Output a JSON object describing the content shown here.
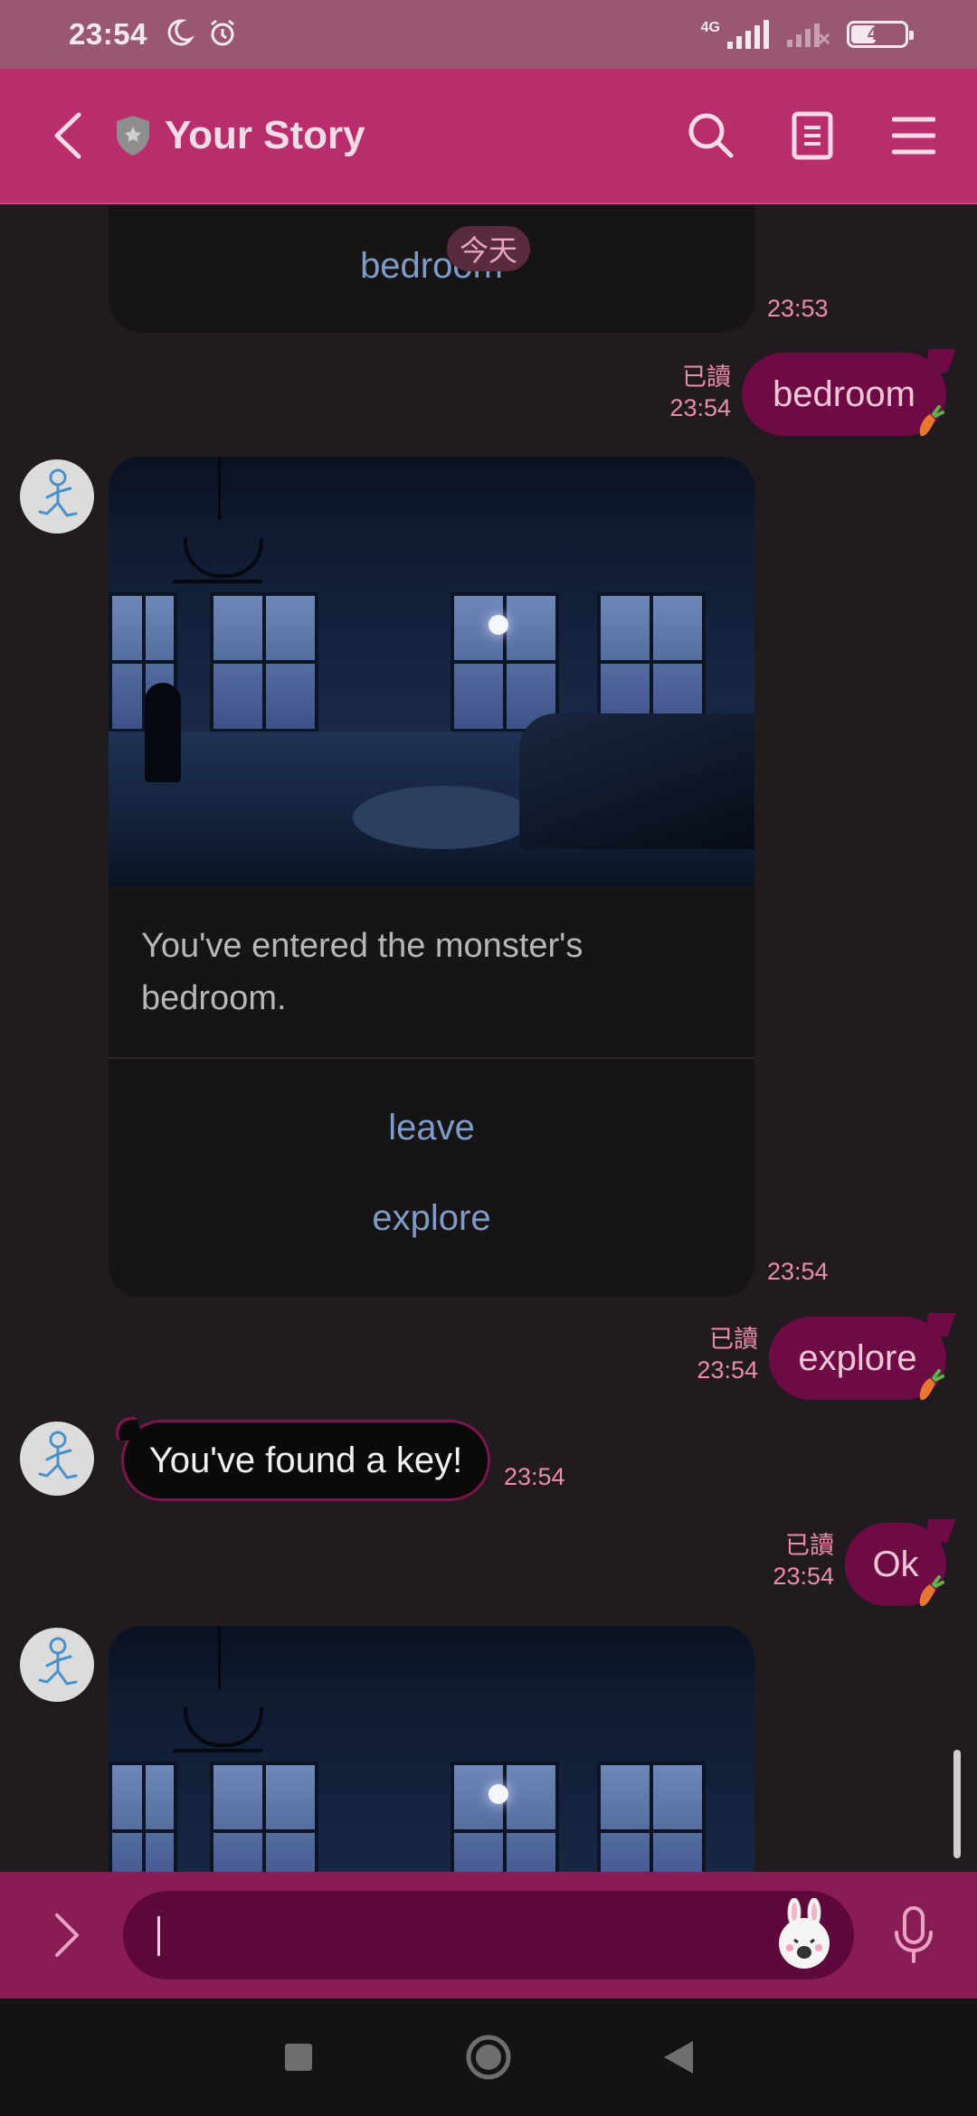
{
  "status_bar": {
    "time": "23:54",
    "network": "4G",
    "battery": "44"
  },
  "header": {
    "title": "Your Story",
    "icons": [
      "back-arrow-icon",
      "shield-icon",
      "search-icon",
      "notes-icon",
      "menu-icon"
    ]
  },
  "chat": {
    "date_chip": "今天",
    "messages": [
      {
        "type": "card-partial",
        "link": "bedroom",
        "time": "23:53"
      },
      {
        "type": "out",
        "text": "bedroom",
        "read": "已讀",
        "time": "23:54"
      },
      {
        "type": "card",
        "image": "dark-bedroom-scene",
        "text": "You've entered the monster's bedroom.",
        "buttons": [
          "leave",
          "explore"
        ],
        "time": "23:54"
      },
      {
        "type": "out",
        "text": "explore",
        "read": "已讀",
        "time": "23:54"
      },
      {
        "type": "in",
        "text": "You've found a key!",
        "time": "23:54"
      },
      {
        "type": "out",
        "text": "Ok",
        "read": "已讀",
        "time": "23:54"
      },
      {
        "type": "card-image-partial",
        "image": "dark-bedroom-scene"
      }
    ]
  },
  "input": {
    "value": "",
    "icons": [
      "expand-arrow-icon",
      "sticker-icon",
      "microphone-icon"
    ]
  },
  "nav": {
    "icons": [
      "recents-square-icon",
      "home-circle-icon",
      "back-triangle-icon"
    ]
  },
  "colors": {
    "header": "#b92d6c",
    "status_bar": "#9a5774",
    "background": "#211b1f",
    "outgoing_bubble": "#6e0a44",
    "timestamp": "#ea8cae",
    "link": "#7f9bc8",
    "input_bar": "#881d56"
  }
}
